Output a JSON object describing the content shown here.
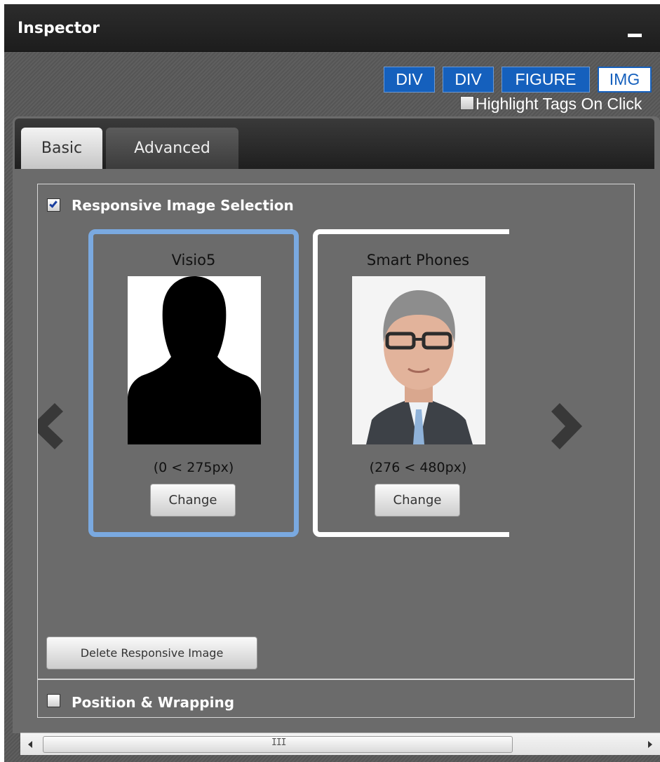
{
  "window": {
    "title": "Inspector"
  },
  "breadcrumb": [
    "DIV",
    "DIV",
    "FIGURE",
    "IMG"
  ],
  "highlight_tags": {
    "label": "Highlight Tags On Click",
    "checked": false
  },
  "tabs": [
    {
      "label": "Basic",
      "active": true
    },
    {
      "label": "Advanced",
      "active": false
    }
  ],
  "responsive_image_selection": {
    "label": "Responsive Image Selection",
    "checked": true,
    "cards": [
      {
        "title": "Visio5",
        "range": "(0 < 275px)",
        "button": "Change",
        "selected": true,
        "image": "silhouette-placeholder"
      },
      {
        "title": "Smart Phones",
        "range": "(276 < 480px)",
        "button": "Change",
        "selected": false,
        "image": "man-with-glasses-photo"
      }
    ]
  },
  "delete_button": "Delete Responsive Image",
  "position_wrapping": {
    "label": "Position & Wrapping",
    "checked": false
  },
  "scrollbar": {
    "grip": "III"
  },
  "colors": {
    "accent": "#1560bd",
    "selected_card": "#7aa9e0",
    "panel": "#6b6b6b"
  }
}
